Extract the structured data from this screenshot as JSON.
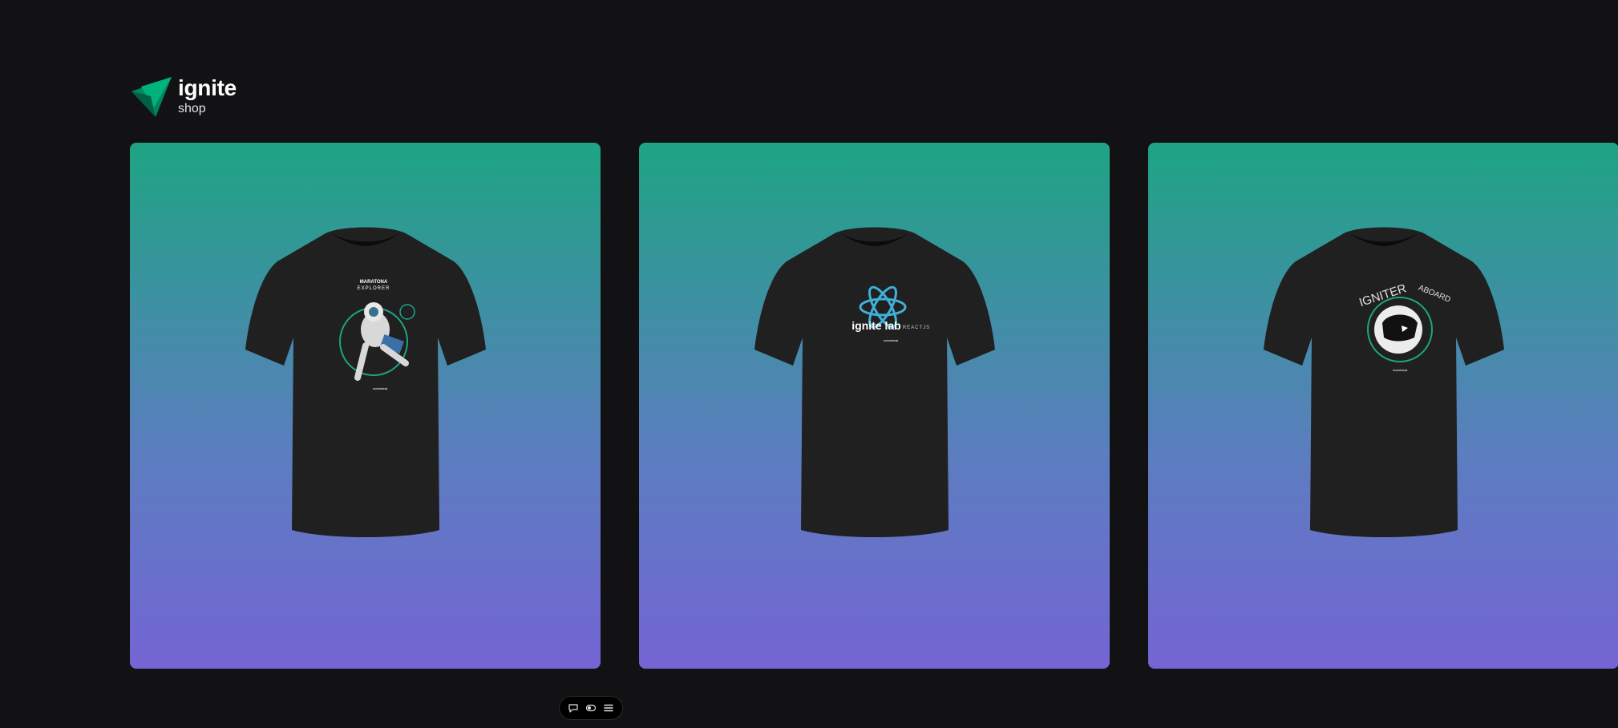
{
  "brand": {
    "name": "ignite",
    "sub": "shop",
    "icon": "ignite-logo-icon",
    "color_primary": "#00875f",
    "color_secondary": "#00b37e"
  },
  "products": [
    {
      "print_lines": [
        "MARATONA",
        "EXPLORER"
      ],
      "brand_tag": "rocketseat",
      "artwork": "astronaut-icon"
    },
    {
      "print_main": "ignite lab",
      "print_sub": "REACTJS",
      "brand_tag": "rocketseat",
      "artwork": "atom-icon"
    },
    {
      "print_main": "IGNITER",
      "print_sub": "ABOARD",
      "brand_tag": "rocketseat",
      "artwork": "helmet-icon"
    }
  ],
  "colors": {
    "background": "#121214",
    "gradient_top": "#1ea483",
    "gradient_bottom": "#7465d4",
    "shirt": "#1f1f1f"
  },
  "toolbar": {
    "buttons": [
      "comment-icon",
      "toggle-icon",
      "menu-icon"
    ]
  }
}
